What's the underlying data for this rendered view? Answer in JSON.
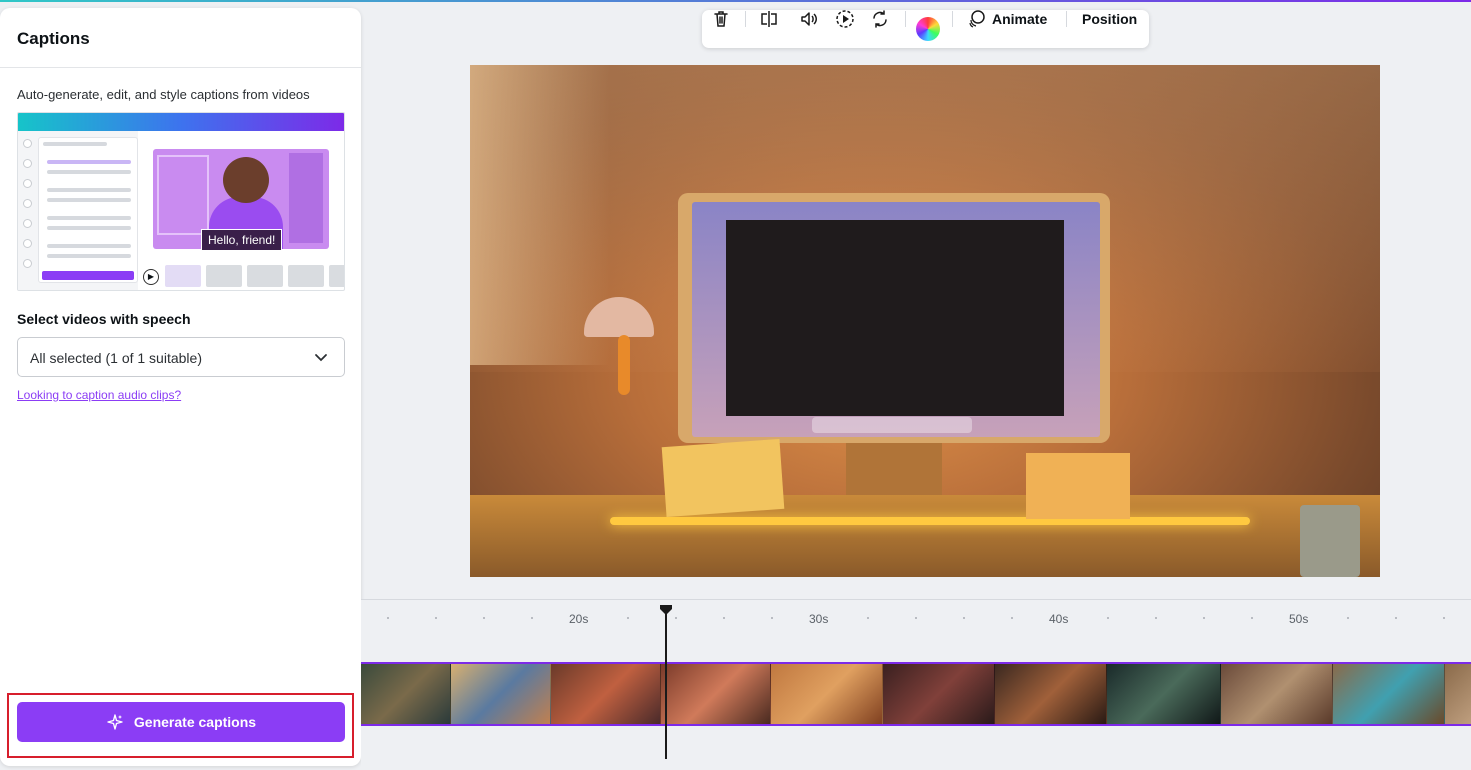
{
  "panel": {
    "title": "Captions",
    "description": "Auto-generate, edit, and style captions from videos",
    "illustration_caption": "Hello, friend!",
    "select_label": "Select videos with speech",
    "dropdown_value": "All selected (1 of 1 suitable)",
    "link_text": "Looking to caption audio clips?",
    "generate_label": "Generate captions"
  },
  "toolbar": {
    "icons": [
      "trash-icon",
      "flip-icon",
      "volume-icon",
      "play-speed-icon",
      "loop-icon",
      "color-icon"
    ],
    "animate_label": "Animate",
    "position_label": "Position"
  },
  "timeline": {
    "labels": [
      "20s",
      "30s",
      "40s",
      "50s"
    ]
  },
  "colors": {
    "accent": "#8b3df5",
    "highlight_frame": "#d71e2c",
    "clip_border": "#7d2ae8"
  }
}
